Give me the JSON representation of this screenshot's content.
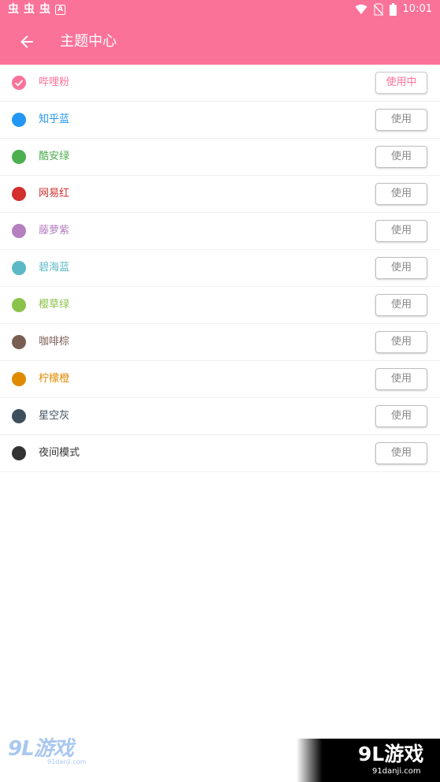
{
  "status_bar": {
    "left_icons": [
      "bug-icon",
      "bug-icon",
      "bug-icon",
      "a-notification-icon"
    ],
    "bug_glyph": "虫",
    "a_glyph": "A",
    "time": "10:01"
  },
  "toolbar": {
    "title": "主题中心",
    "color": "#fb7299"
  },
  "themes": [
    {
      "name": "哔哩粉",
      "color": "#fb7299",
      "button": "使用中",
      "selected": true
    },
    {
      "name": "知乎蓝",
      "color": "#2196f3",
      "button": "使用",
      "selected": false
    },
    {
      "name": "酷安绿",
      "color": "#4caf50",
      "button": "使用",
      "selected": false
    },
    {
      "name": "网易红",
      "color": "#d32f2f",
      "button": "使用",
      "selected": false
    },
    {
      "name": "藤萝紫",
      "color": "#b57fc0",
      "button": "使用",
      "selected": false
    },
    {
      "name": "碧海蓝",
      "color": "#5bb8c6",
      "button": "使用",
      "selected": false
    },
    {
      "name": "樱草绿",
      "color": "#8bc34a",
      "button": "使用",
      "selected": false
    },
    {
      "name": "咖啡棕",
      "color": "#795f53",
      "button": "使用",
      "selected": false
    },
    {
      "name": "柠檬橙",
      "color": "#e08a00",
      "button": "使用",
      "selected": false
    },
    {
      "name": "星空灰",
      "color": "#3d4f5c",
      "button": "使用",
      "selected": false
    },
    {
      "name": "夜间模式",
      "color": "#333333",
      "button": "使用",
      "selected": false
    }
  ],
  "watermark": {
    "logo_text": "9L游戏",
    "site": "91danji.com"
  }
}
